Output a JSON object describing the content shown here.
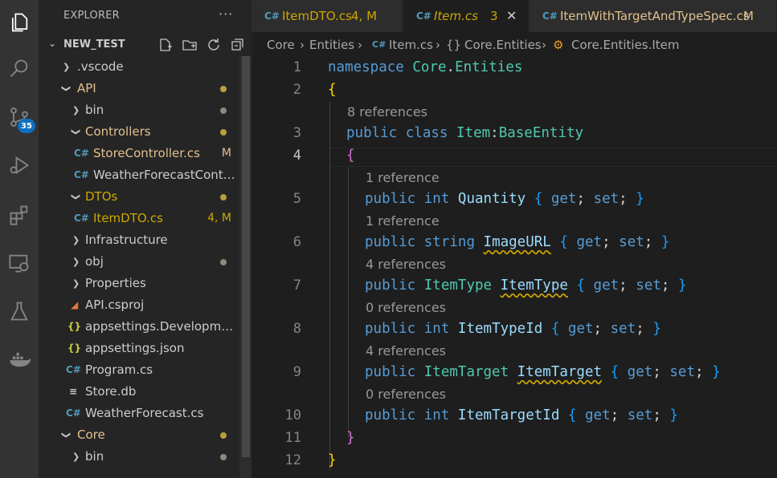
{
  "activity_bar": {
    "icons": [
      "explorer-icon",
      "search-icon",
      "source-control-icon",
      "run-debug-icon",
      "extensions-icon",
      "remote-explorer-icon",
      "testing-icon",
      "docker-icon"
    ],
    "scm_badge": "35"
  },
  "sidebar": {
    "title": "EXPLORER",
    "more": "···",
    "workspace": "NEW_TEST",
    "tree": [
      {
        "label": ".vscode",
        "deco": ""
      },
      {
        "label": "API",
        "deco": ""
      },
      {
        "label": "bin",
        "deco": ""
      },
      {
        "label": "Controllers",
        "deco": ""
      },
      {
        "label": "StoreController.cs",
        "deco": "M"
      },
      {
        "label": "WeatherForecastControll...",
        "deco": ""
      },
      {
        "label": "DTOs",
        "deco": ""
      },
      {
        "label": "ItemDTO.cs",
        "deco": "4, M"
      },
      {
        "label": "Infrastructure",
        "deco": ""
      },
      {
        "label": "obj",
        "deco": ""
      },
      {
        "label": "Properties",
        "deco": ""
      },
      {
        "label": "API.csproj",
        "deco": ""
      },
      {
        "label": "appsettings.Development.j...",
        "deco": ""
      },
      {
        "label": "appsettings.json",
        "deco": ""
      },
      {
        "label": "Program.cs",
        "deco": ""
      },
      {
        "label": "Store.db",
        "deco": ""
      },
      {
        "label": "WeatherForecast.cs",
        "deco": ""
      },
      {
        "label": "Core",
        "deco": ""
      },
      {
        "label": "bin",
        "deco": ""
      }
    ]
  },
  "tabs": [
    {
      "label": "ItemDTO.cs",
      "status": "4, M"
    },
    {
      "label": "Item.cs",
      "status": "3"
    },
    {
      "label": "ItemWithTargetAndTypeSpec.cs",
      "status": "M"
    }
  ],
  "breadcrumb": [
    "Core",
    "Entities",
    "Item.cs",
    "Core.Entities",
    "Core.Entities.Item"
  ],
  "editor": {
    "line_numbers": [
      "1",
      "2",
      "3",
      "4",
      "5",
      "6",
      "7",
      "8",
      "9",
      "10",
      "11",
      "12"
    ],
    "codelens": [
      "8 references",
      "1 reference",
      "1 reference",
      "4 references",
      "0 references",
      "4 references",
      "0 references"
    ],
    "tokens": {
      "namespace": "namespace",
      "core": "Core",
      "dot": ".",
      "entities": "Entities",
      "open": "{",
      "close": "}",
      "public": "public",
      "class": "class",
      "item": "Item",
      "colon": ":",
      "base": "BaseEntity",
      "int": "int",
      "string": "string",
      "get": "get",
      "set": "set",
      "semi": ";",
      "quantity": "Quantity",
      "imageurl": "ImageURL",
      "itemtype_t": "ItemType",
      "itemtype_p": "ItemType",
      "itemtypeid": "ItemTypeId",
      "itemtarget_t": "ItemTarget",
      "itemtarget_p": "ItemTarget",
      "itemtargetid": "ItemTargetId"
    }
  },
  "colors": {
    "keyword": "#569cd6",
    "type": "#4ec9b0",
    "property": "#9cdcfe",
    "modified": "#e2c08d",
    "warning": "#cca700"
  }
}
